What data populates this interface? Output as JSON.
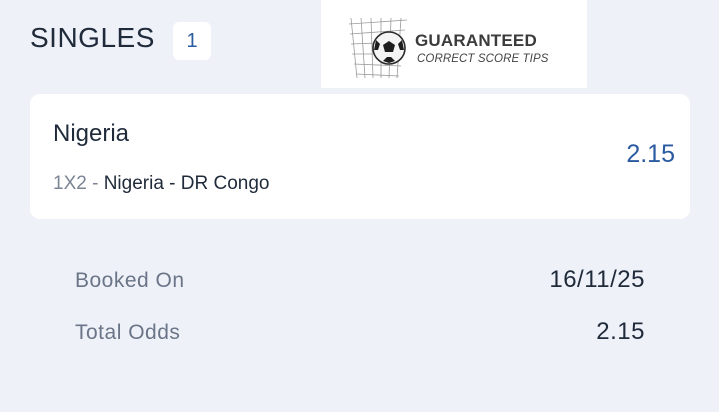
{
  "header": {
    "title": "SINGLES",
    "count": "1"
  },
  "logo": {
    "title": "GUARANTEED",
    "subtitle": "CORRECT SCORE TIPS",
    "icon": "soccer-ball-net-icon"
  },
  "bet": {
    "selection": "Nigeria",
    "market": "1X2",
    "separator": " - ",
    "match": "Nigeria - DR Congo",
    "odds": "2.15"
  },
  "summary": {
    "booked_label": "Booked On",
    "booked_value": "16/11/25",
    "total_label": "Total Odds",
    "total_value": "2.15"
  },
  "colors": {
    "background": "#eef1f8",
    "card": "#ffffff",
    "accent": "#2a5aa0",
    "text": "#1f2a3a",
    "muted": "#6b7588"
  }
}
